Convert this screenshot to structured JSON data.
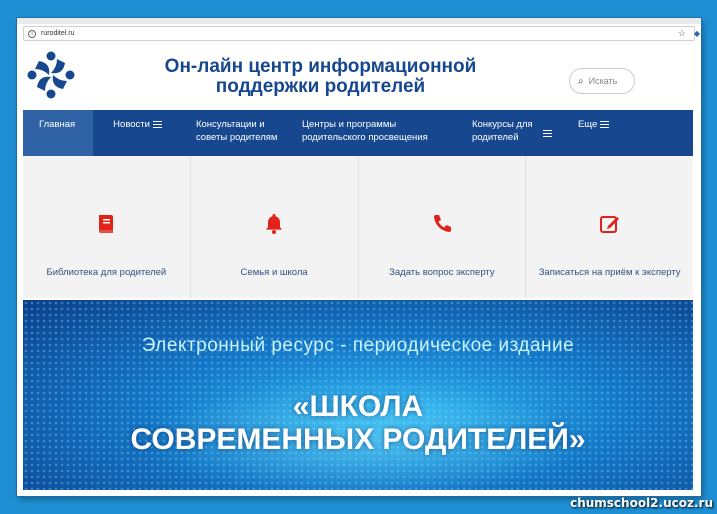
{
  "browser": {
    "url": "ruroditel.ru"
  },
  "header": {
    "title_line1": "Он-лайн центр информационной",
    "title_line2": "поддержки родителей",
    "search_placeholder": "Искать"
  },
  "nav": {
    "items": [
      {
        "line1": "Главная",
        "line2": ""
      },
      {
        "line1": "Новости",
        "line2": ""
      },
      {
        "line1": "Консультации и",
        "line2": "советы родителям"
      },
      {
        "line1": "Центры и программы",
        "line2": "родительского просвещения"
      },
      {
        "line1": "Конкурсы для",
        "line2": "родителей"
      },
      {
        "line1": "Еще",
        "line2": ""
      }
    ]
  },
  "cards": [
    {
      "label": "Библиотека для родителей",
      "icon": "book-icon"
    },
    {
      "label": "Семья и школа",
      "icon": "bell-icon"
    },
    {
      "label": "Задать вопрос эксперту",
      "icon": "phone-icon"
    },
    {
      "label": "Записаться на приём к эксперту",
      "icon": "edit-icon"
    }
  ],
  "banner": {
    "subtitle": "Электронный ресурс - периодическое издание",
    "title_line1": "«ШКОЛА",
    "title_line2": "СОВРЕМЕННЫХ РОДИТЕЛЕЙ»"
  },
  "watermark": "chumschool2.ucoz.ru",
  "colors": {
    "brand_blue": "#17488f",
    "accent_red": "#e2231a",
    "page_bg": "#1f8fd3"
  }
}
